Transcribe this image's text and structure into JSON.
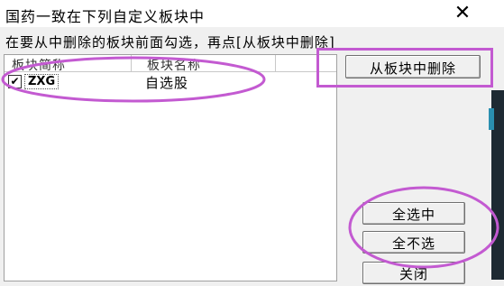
{
  "window": {
    "title": "国药一致在下列自定义板块中",
    "close_symbol": "✕"
  },
  "instruction": "在要从中删除的板块前面勾选，再点[从板块中删除]",
  "list": {
    "columns": [
      "板块简称",
      "板块名称"
    ],
    "rows": [
      {
        "checked": true,
        "code": "ZXG",
        "name": "自选股"
      }
    ]
  },
  "buttons": {
    "remove_label": "从板块中删除",
    "select_all_label": "全选中",
    "select_none_label": "全不选",
    "close_label": "关闭"
  },
  "checkbox_mark": "✔",
  "annotation_color": "#c35ad1"
}
